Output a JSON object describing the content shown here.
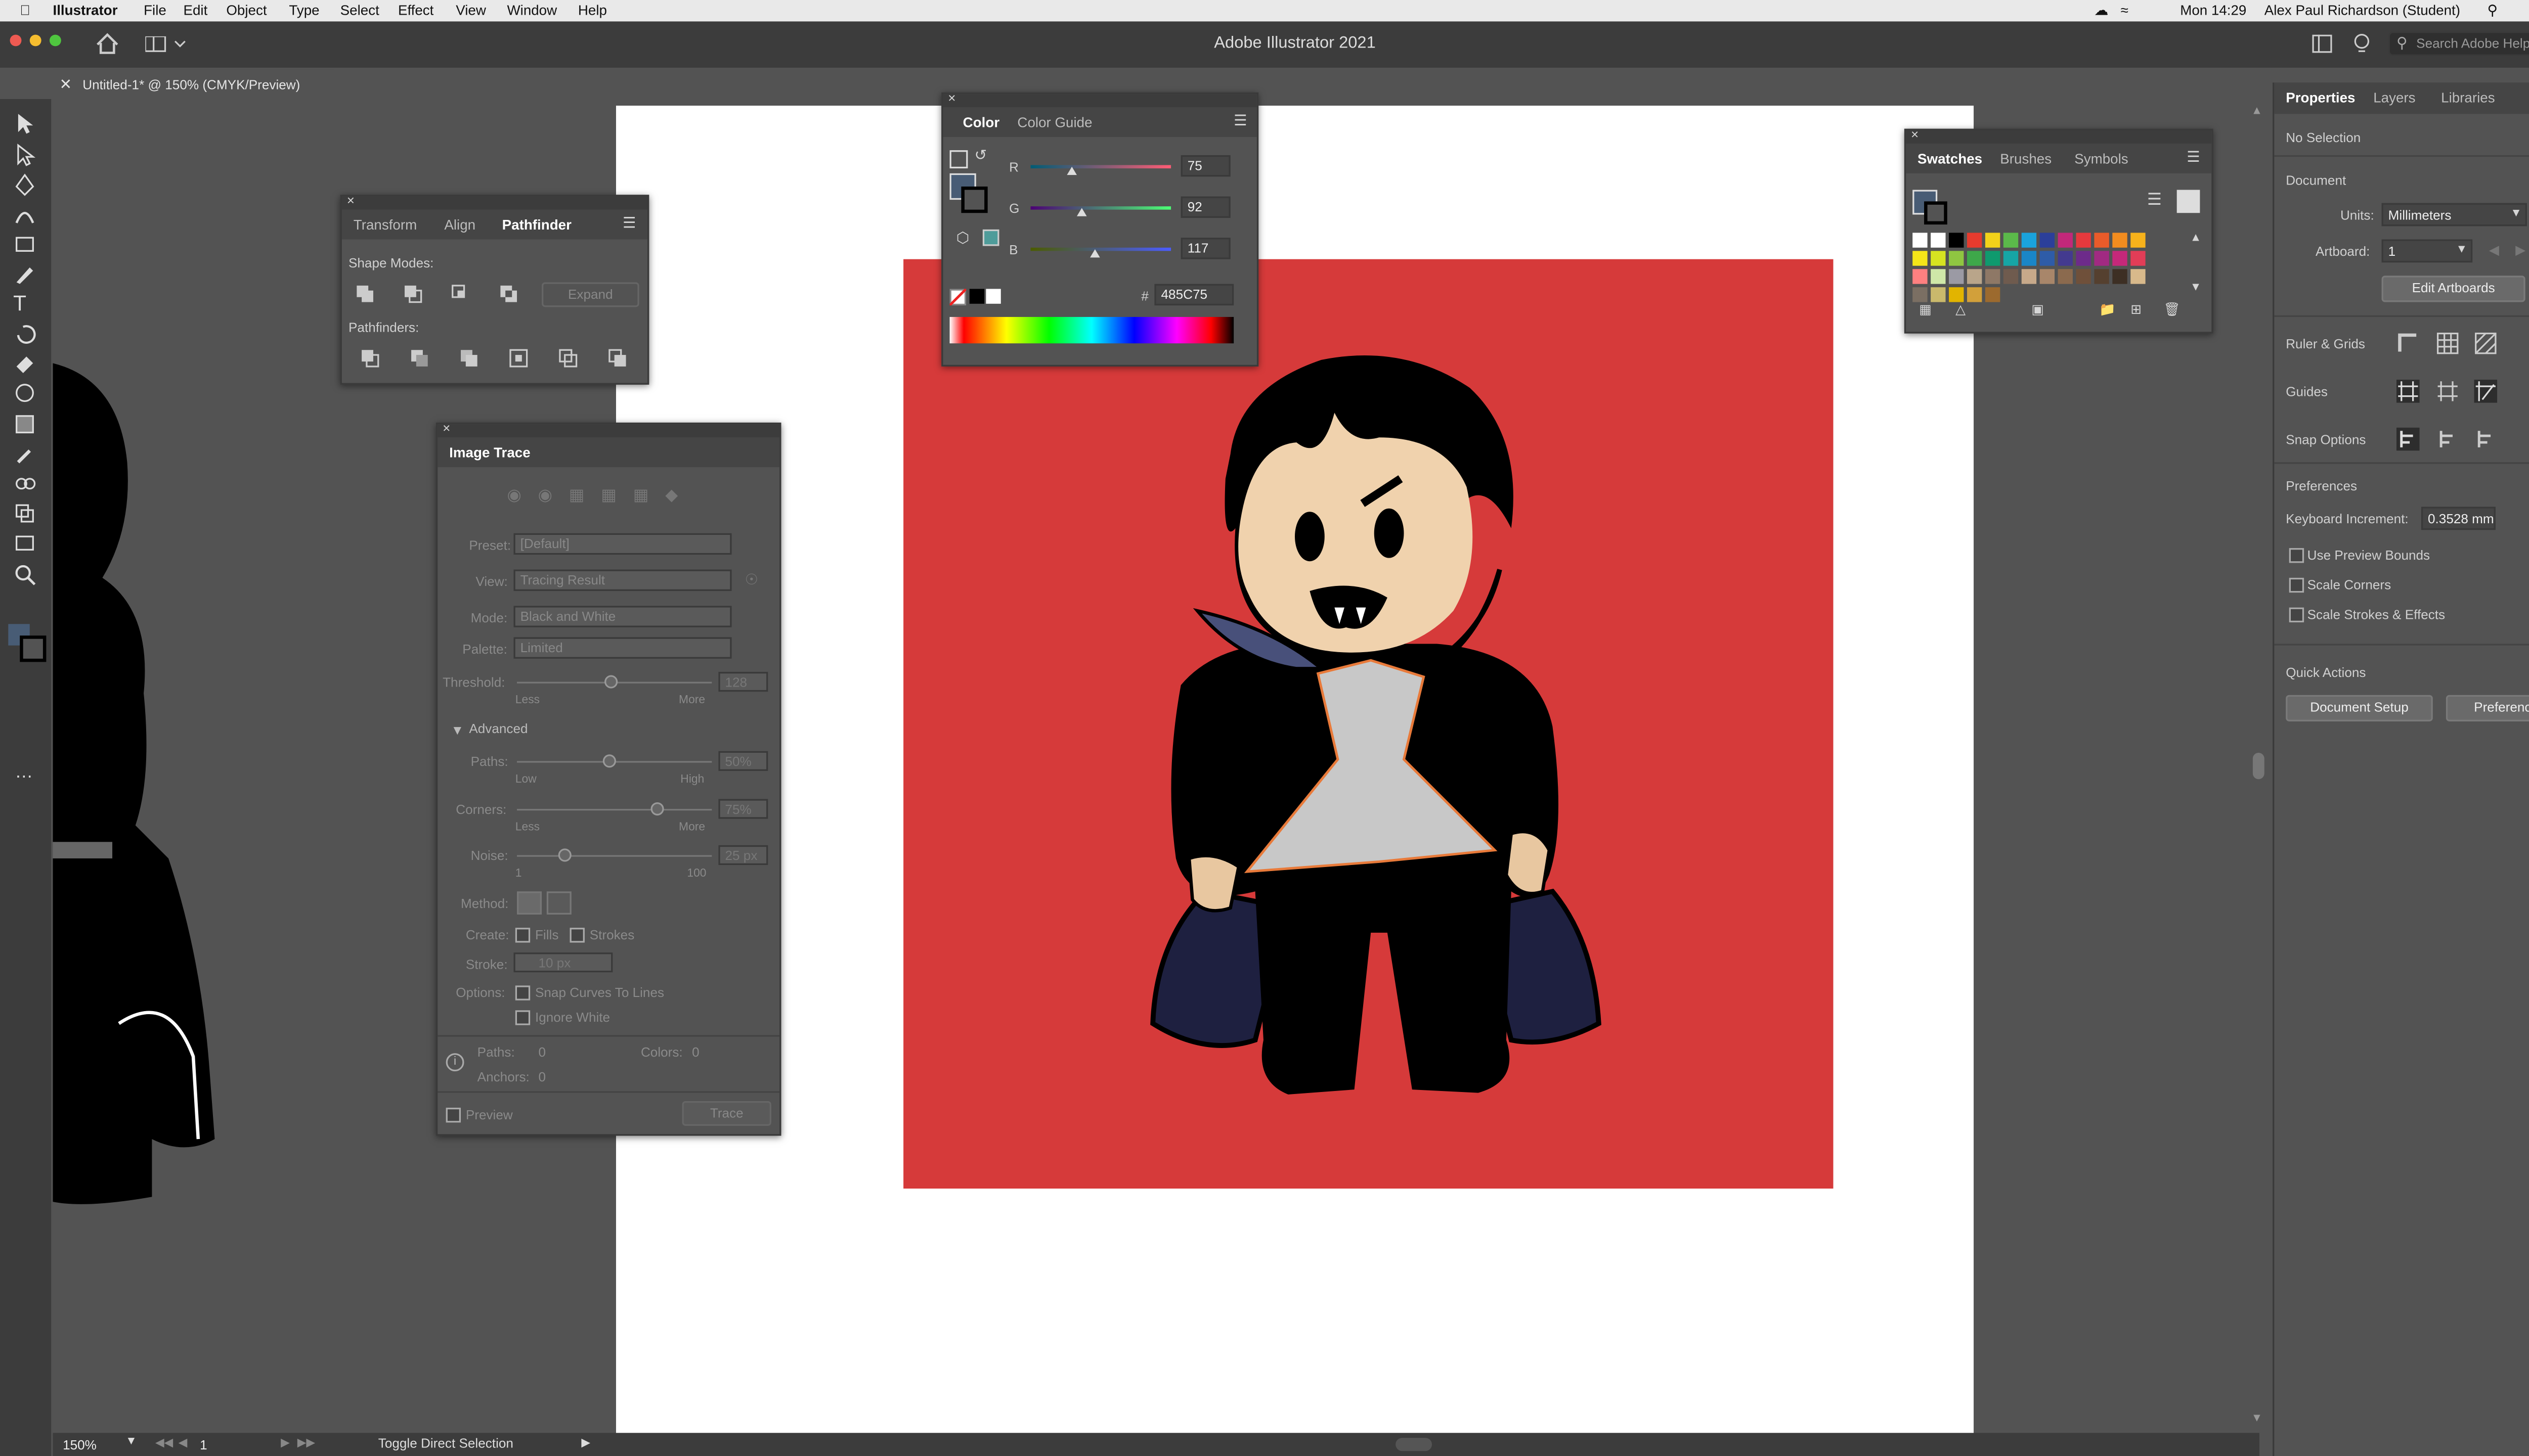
{
  "menubar": {
    "app": "Illustrator",
    "items": [
      "File",
      "Edit",
      "Object",
      "Type",
      "Select",
      "Effect",
      "View",
      "Window",
      "Help"
    ],
    "clock": "Mon 14:29",
    "user": "Alex Paul Richardson (Student)"
  },
  "titlebar": {
    "title": "Adobe Illustrator 2021",
    "search_placeholder": "Search Adobe Help"
  },
  "document": {
    "tab_label": "Untitled-1* @ 150% (CMYK/Preview)"
  },
  "pathfinder": {
    "tabs": [
      "Transform",
      "Align",
      "Pathfinder"
    ],
    "shape_modes_label": "Shape Modes:",
    "expand_label": "Expand",
    "pathfinders_label": "Pathfinders:"
  },
  "color_panel": {
    "tabs": [
      "Color",
      "Color Guide"
    ],
    "r_label": "R",
    "g_label": "G",
    "b_label": "B",
    "r": "75",
    "g": "92",
    "b": "117",
    "r_frac": 0.294,
    "g_frac": 0.361,
    "b_frac": 0.459,
    "hex_label": "#",
    "hex": "485C75",
    "fill_color": "#485C75"
  },
  "swatches": {
    "tabs": [
      "Swatches",
      "Brushes",
      "Symbols"
    ]
  },
  "image_trace": {
    "title": "Image Trace",
    "preset_label": "Preset:",
    "preset_value": "[Default]",
    "view_label": "View:",
    "view_value": "Tracing Result",
    "mode_label": "Mode:",
    "mode_value": "Black and White",
    "palette_label": "Palette:",
    "palette_value": "Limited",
    "threshold_label": "Threshold:",
    "threshold_value": "128",
    "less": "Less",
    "more": "More",
    "advanced_label": "Advanced",
    "paths_label": "Paths:",
    "paths_value": "50%",
    "low": "Low",
    "high": "High",
    "corners_label": "Corners:",
    "corners_value": "75%",
    "noise_label": "Noise:",
    "noise_value": "25 px",
    "noise_min": "1",
    "noise_max": "100",
    "method_label": "Method:",
    "create_label": "Create:",
    "fills_label": "Fills",
    "strokes_label": "Strokes",
    "stroke_label": "Stroke:",
    "stroke_value": "10 px",
    "options_label": "Options:",
    "snap_label": "Snap Curves To Lines",
    "ignore_white_label": "Ignore White",
    "info_paths_label": "Paths:",
    "info_paths": "0",
    "info_colors_label": "Colors:",
    "info_colors": "0",
    "info_anchors_label": "Anchors:",
    "info_anchors": "0",
    "preview_label": "Preview",
    "trace_label": "Trace"
  },
  "properties": {
    "tabs": [
      "Properties",
      "Layers",
      "Libraries"
    ],
    "no_selection": "No Selection",
    "document_label": "Document",
    "units_label": "Units:",
    "units_value": "Millimeters",
    "artboard_label": "Artboard:",
    "artboard_value": "1",
    "edit_artboards": "Edit Artboards",
    "ruler_grids": "Ruler & Grids",
    "guides": "Guides",
    "snap_options": "Snap Options",
    "preferences_label": "Preferences",
    "keyboard_increment_label": "Keyboard Increment:",
    "keyboard_increment_value": "0.3528 mm",
    "use_preview_bounds": "Use Preview Bounds",
    "scale_corners": "Scale Corners",
    "scale_strokes": "Scale Strokes & Effects",
    "quick_actions": "Quick Actions",
    "document_setup": "Document Setup",
    "preferences_button": "Preferences"
  },
  "status": {
    "zoom": "150%",
    "artboard": "1",
    "tool": "Toggle Direct Selection"
  }
}
